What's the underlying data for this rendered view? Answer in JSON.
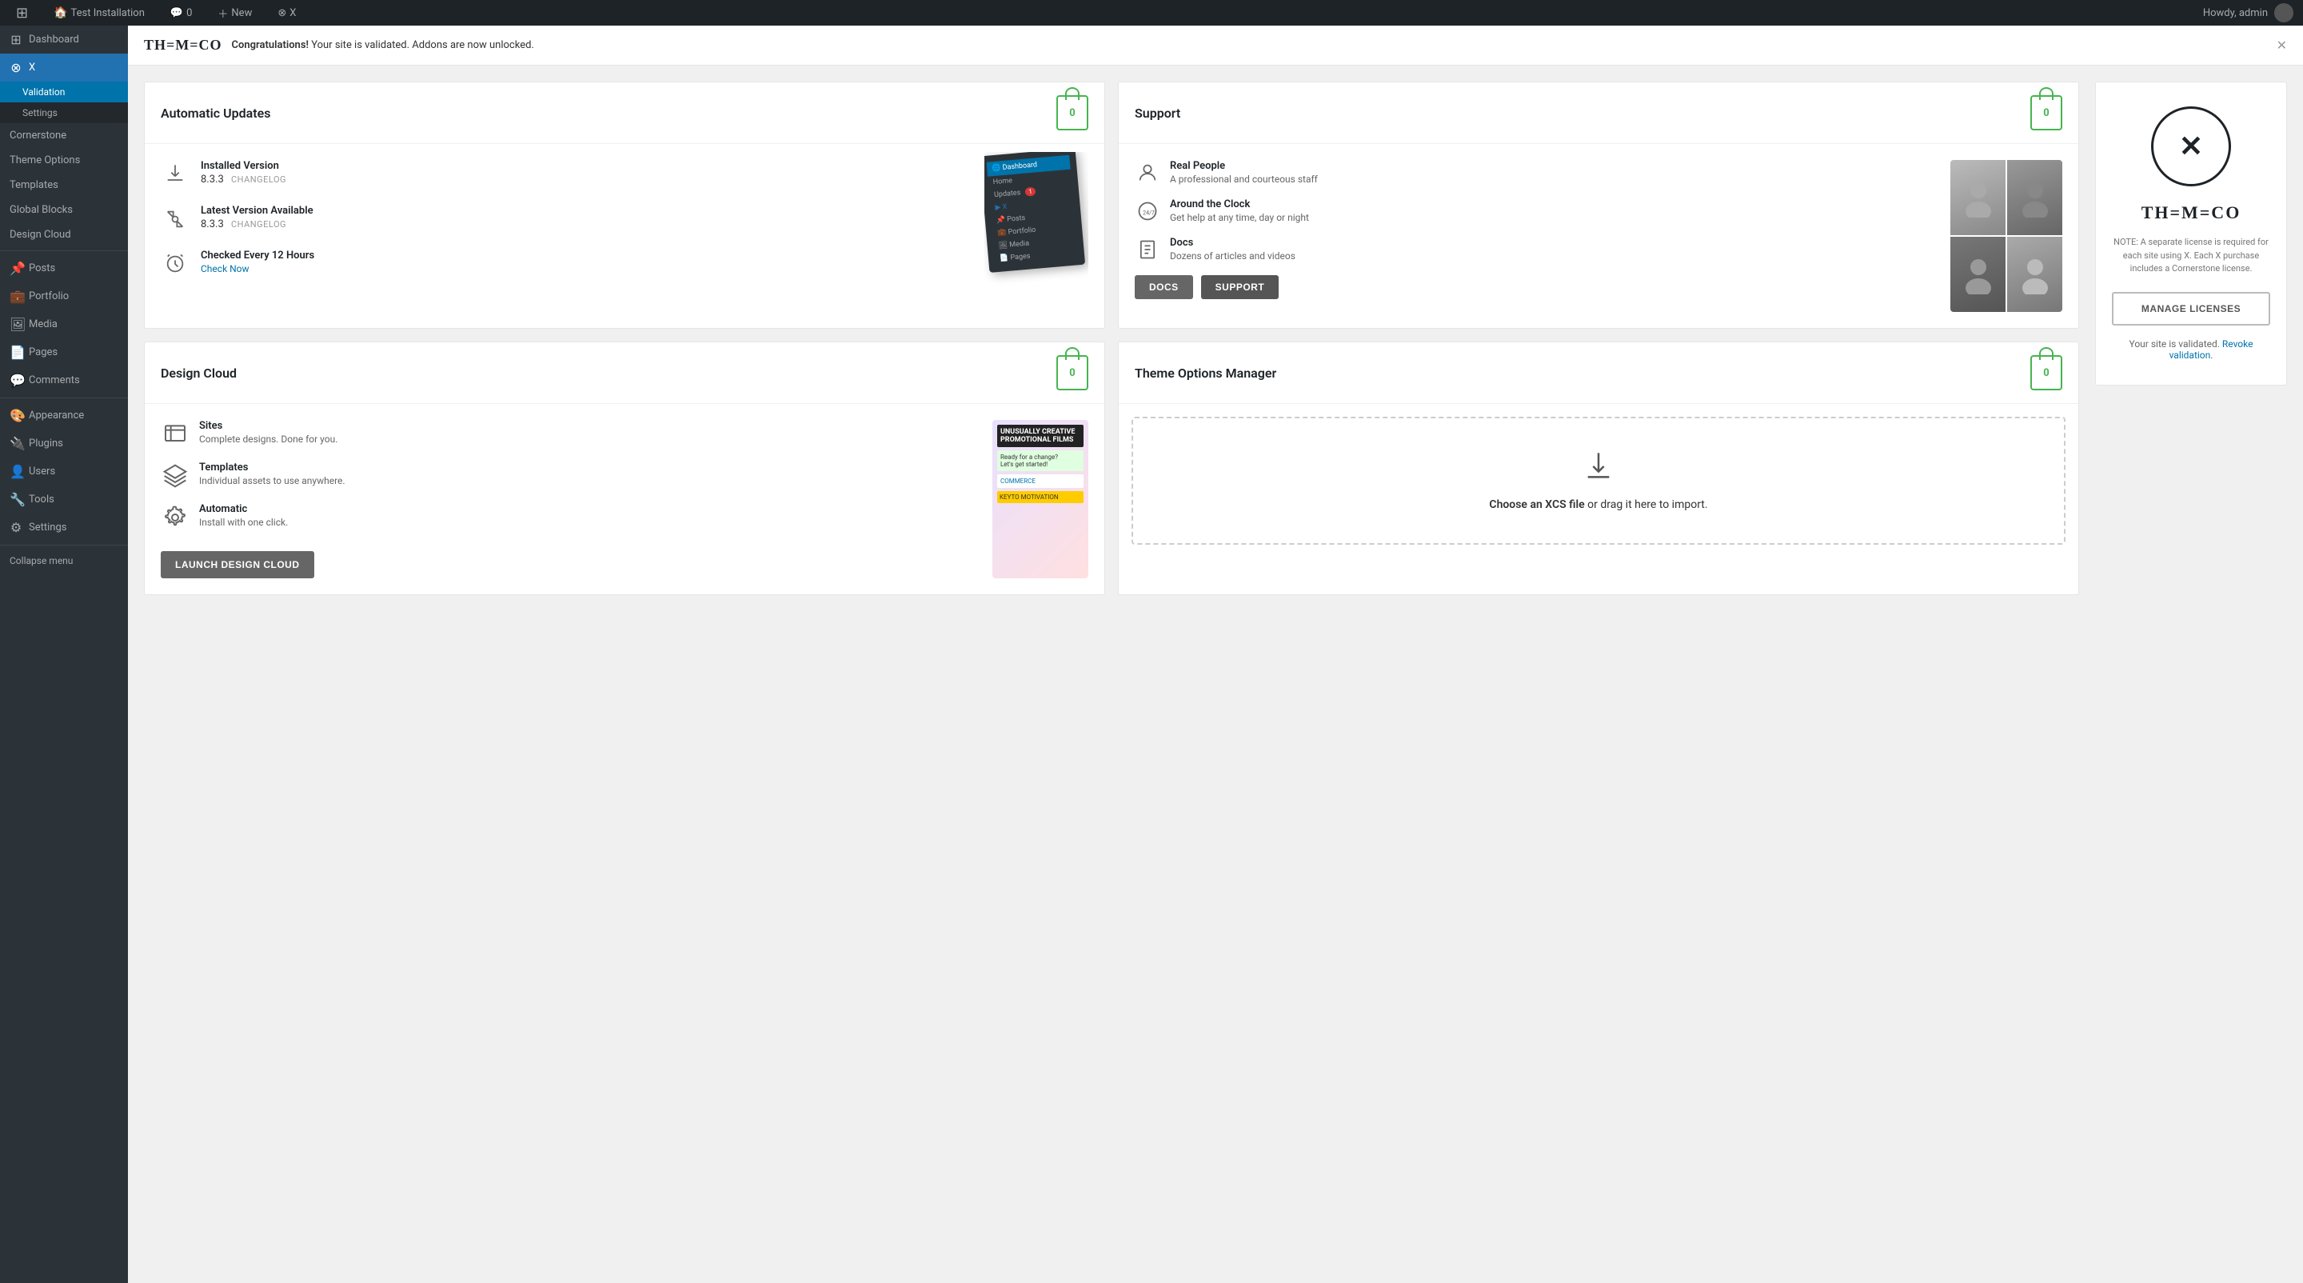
{
  "adminbar": {
    "site_name": "Test Installation",
    "new_label": "New",
    "comment_count": "0",
    "x_label": "X",
    "howdy": "Howdy, admin"
  },
  "sidebar": {
    "dashboard_label": "Dashboard",
    "x_label": "X",
    "validation_label": "Validation",
    "settings_label": "Settings",
    "cornerstone_label": "Cornerstone",
    "theme_options_label": "Theme Options",
    "templates_label": "Templates",
    "global_blocks_label": "Global Blocks",
    "design_cloud_label": "Design Cloud",
    "posts_label": "Posts",
    "portfolio_label": "Portfolio",
    "media_label": "Media",
    "pages_label": "Pages",
    "comments_label": "Comments",
    "appearance_label": "Appearance",
    "plugins_label": "Plugins",
    "users_label": "Users",
    "tools_label": "Tools",
    "settings_menu_label": "Settings",
    "collapse_label": "Collapse menu"
  },
  "notice": {
    "logo": "TH=M=CO",
    "message_strong": "Congratulations!",
    "message": " Your site is validated. Addons are now unlocked."
  },
  "updates_panel": {
    "title": "Automatic Updates",
    "lock_num": "0",
    "installed_version_label": "Installed Version",
    "installed_version": "8.3.3",
    "installed_changelog": "CHANGELOG",
    "latest_version_label": "Latest Version Available",
    "latest_version": "8.3.3",
    "latest_changelog": "CHANGELOG",
    "check_label": "Checked Every 12 Hours",
    "check_now": "Check Now"
  },
  "support_panel": {
    "title": "Support",
    "lock_num": "0",
    "real_people_label": "Real People",
    "real_people_desc": "A professional and courteous staff",
    "clock_label": "Around the Clock",
    "clock_desc": "Get help at any time, day or night",
    "docs_label": "Docs",
    "docs_desc": "Dozens of articles and videos",
    "btn_docs": "DOCS",
    "btn_support": "SUPPORT"
  },
  "design_cloud_panel": {
    "title": "Design Cloud",
    "lock_num": "0",
    "sites_label": "Sites",
    "sites_desc": "Complete designs. Done for you.",
    "templates_label": "Templates",
    "templates_desc": "Individual assets to use anywhere.",
    "automatic_label": "Automatic",
    "automatic_desc": "Install with one click.",
    "btn_launch": "LAUNCH DESIGN CLOUD"
  },
  "theme_options_panel": {
    "title": "Theme Options Manager",
    "lock_num": "0",
    "drop_text_strong": "Choose an XCS file",
    "drop_text": " or drag it here to import."
  },
  "right_sidebar": {
    "x_symbol": "✕",
    "logo_text": "TH=M=CO",
    "note": "NOTE: A separate license is required for each site using X. Each X purchase includes a Cornerstone license.",
    "manage_btn": "MANAGE LICENSES",
    "validated_text": "Your site is validated. ",
    "revoke_link": "Revoke validation."
  },
  "dashboard_mockup": {
    "header": "🌐 Dashboard",
    "home": "Home",
    "updates": "Updates",
    "updates_badge": "1",
    "x_item": "▶ X",
    "posts": "📌 Posts",
    "portfolio": "💼 Portfolio",
    "media": "🖼 Media",
    "pages": "📄 Pages"
  }
}
